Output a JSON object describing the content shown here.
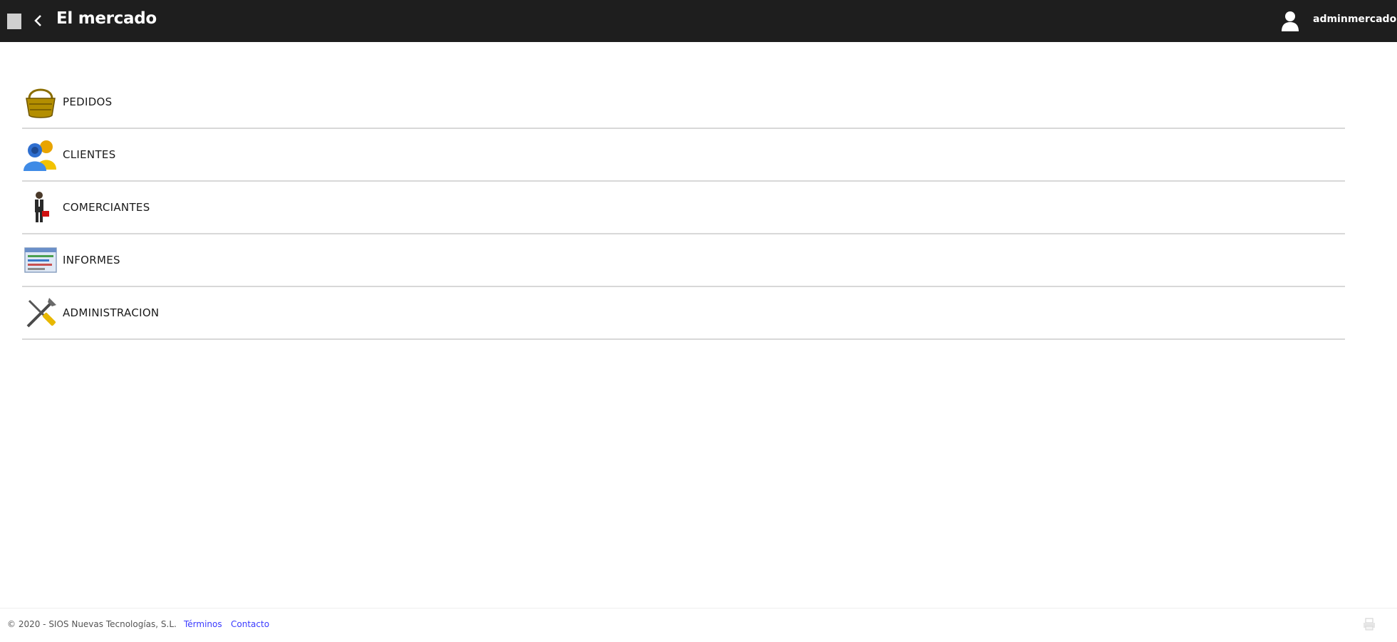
{
  "header": {
    "title": "El mercado",
    "username": "adminmercado",
    "menu_icon": "menu-square-icon",
    "back_icon": "chevron-left-icon",
    "user_icon": "user-icon",
    "background": "#1e1e1e"
  },
  "menu": {
    "items": [
      {
        "label": "PEDIDOS",
        "icon": "basket-icon"
      },
      {
        "label": "CLIENTES",
        "icon": "users-icon"
      },
      {
        "label": "COMERCIANTES",
        "icon": "merchant-icon"
      },
      {
        "label": "INFORMES",
        "icon": "report-icon"
      },
      {
        "label": "ADMINISTRACION",
        "icon": "tools-icon"
      }
    ]
  },
  "footer": {
    "copyright": "© 2020 - SIOS Nuevas Tecnologías, S.L.",
    "terms_label": "Términos",
    "contact_label": "Contacto",
    "link_color": "#3a3aff"
  }
}
